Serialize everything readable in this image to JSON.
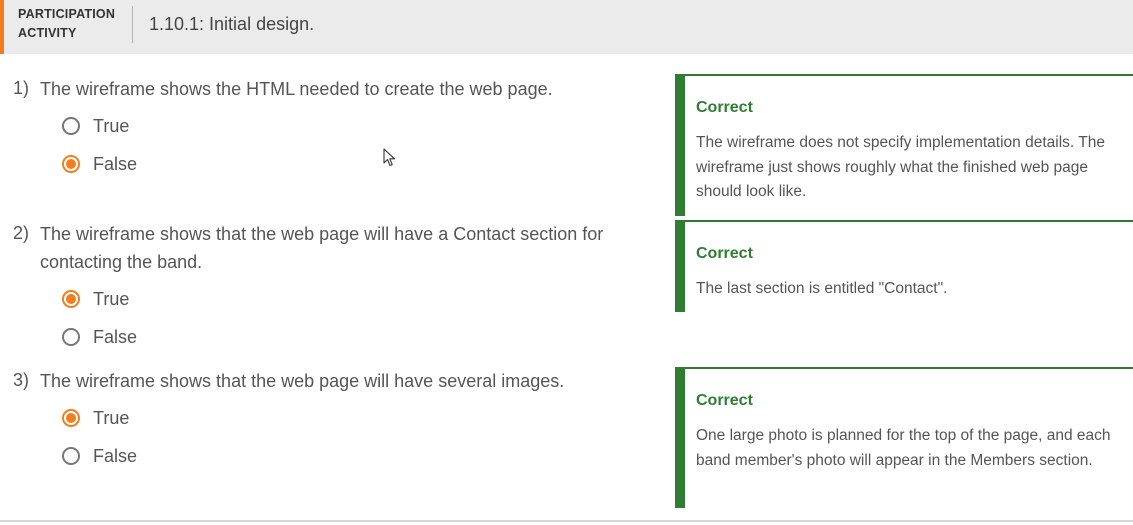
{
  "header": {
    "activity_label_line1": "PARTICIPATION",
    "activity_label_line2": "ACTIVITY",
    "title": "1.10.1: Initial design."
  },
  "colors": {
    "accent": "#f47d20",
    "correct": "#2e7d32",
    "header_bg": "#ebebeb"
  },
  "questions": [
    {
      "number": "1)",
      "text": "The wireframe shows the HTML needed to create the web page.",
      "options": [
        {
          "label": "True",
          "selected": false
        },
        {
          "label": "False",
          "selected": true
        }
      ],
      "feedback": {
        "title": "Correct",
        "text": "The wireframe does not specify implementation details. The wireframe just shows roughly what the finished web page should look like."
      }
    },
    {
      "number": "2)",
      "text": "The wireframe shows that the web page will have a Contact section for contacting the band.",
      "options": [
        {
          "label": "True",
          "selected": true
        },
        {
          "label": "False",
          "selected": false
        }
      ],
      "feedback": {
        "title": "Correct",
        "text": "The last section is entitled \"Contact\"."
      }
    },
    {
      "number": "3)",
      "text": "The wireframe shows that the web page will have several images.",
      "options": [
        {
          "label": "True",
          "selected": true
        },
        {
          "label": "False",
          "selected": false
        }
      ],
      "feedback": {
        "title": "Correct",
        "text": "One large photo is planned for the top of the page, and each band member's photo will appear in the Members section."
      }
    }
  ]
}
